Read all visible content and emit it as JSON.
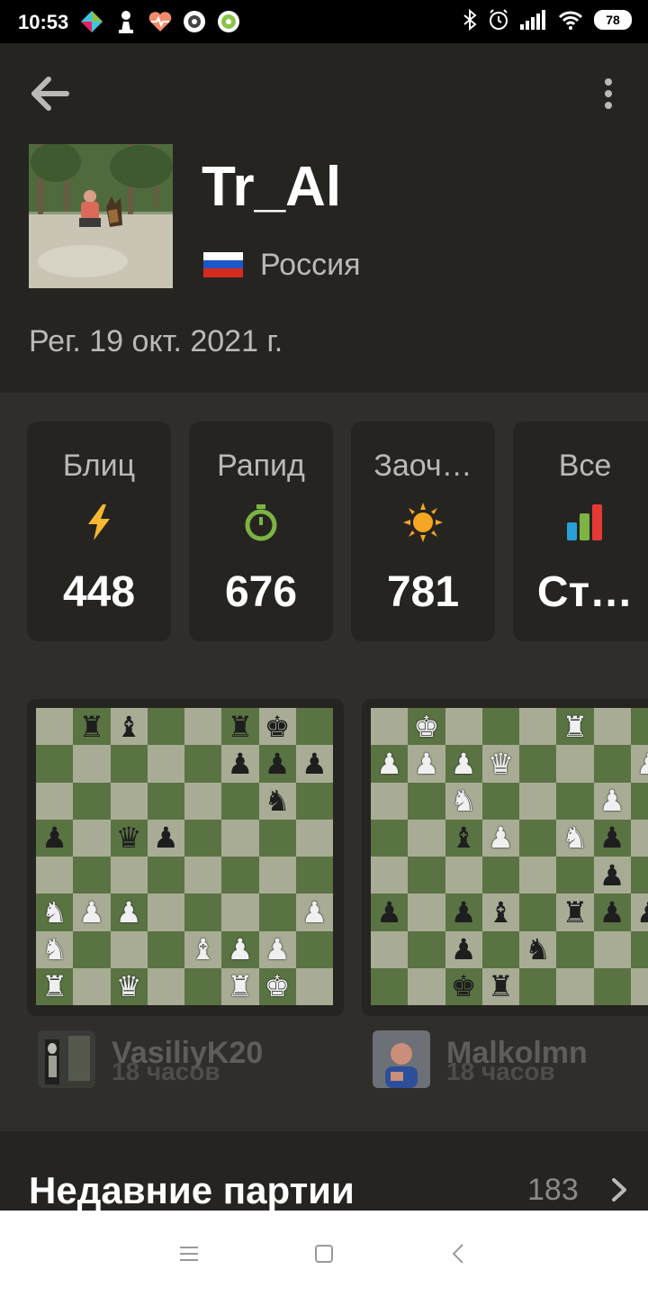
{
  "status_bar": {
    "time": "10:53",
    "battery": "78",
    "icons": [
      "kite-icon",
      "chess-pawn-icon",
      "heart-rate-icon",
      "vpn-icon",
      "settings-gear-icon",
      "bluetooth-icon",
      "alarm-icon",
      "signal-icon",
      "wifi-icon"
    ]
  },
  "header": {
    "back_icon": "arrow-left-icon",
    "menu_icon": "more-vertical-icon",
    "username": "Tr_Al",
    "country": "Россия",
    "flag": "russia-flag",
    "registered": "Рег. 19 окт. 2021 г."
  },
  "ratings": [
    {
      "label": "Блиц",
      "icon": "lightning-icon",
      "color": "#f7b731",
      "value": "448"
    },
    {
      "label": "Рапид",
      "icon": "stopwatch-icon",
      "color": "#7cb342",
      "value": "676"
    },
    {
      "label": "Заоч…",
      "icon": "sun-icon",
      "color": "#f5a623",
      "value": "781"
    },
    {
      "label": "Все",
      "icon": "bar-chart-icon",
      "color": "#e53935",
      "value": "Ст…"
    }
  ],
  "games": [
    {
      "opponent": "VasiliyK20",
      "time": "18 часов"
    },
    {
      "opponent": "Malkolmn",
      "time": "18 часов"
    }
  ],
  "recent": {
    "title": "Недавние партии",
    "count": "183"
  },
  "colors": {
    "background": "#262421",
    "section": "#302e2b",
    "light_square": "#a9ac95",
    "dark_square": "#5a7343"
  }
}
